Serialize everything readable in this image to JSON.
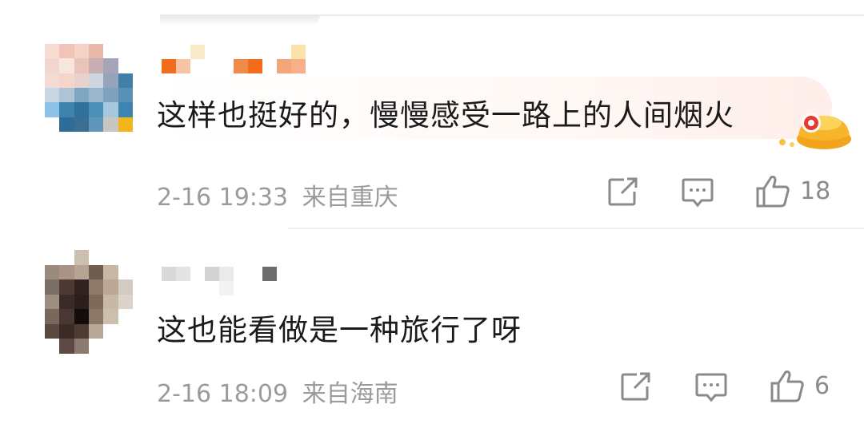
{
  "comments": [
    {
      "text": "这样也挺好的，慢慢感受一路上的人间烟火",
      "date": "2-16 19:33",
      "location": "来自重庆",
      "likes": "18",
      "badge_icon": "gold-ingot-badge-icon"
    },
    {
      "text": "这也能看做是一种旅行了呀",
      "date": "2-16 18:09",
      "location": "来自海南",
      "likes": "6"
    }
  ],
  "icons": {
    "share": "share-icon",
    "comment": "comment-icon",
    "like": "thumbs-up-icon"
  },
  "colors": {
    "text": "#1a1a1a",
    "meta": "#9b9b9b",
    "icon": "#8a8a8a"
  }
}
